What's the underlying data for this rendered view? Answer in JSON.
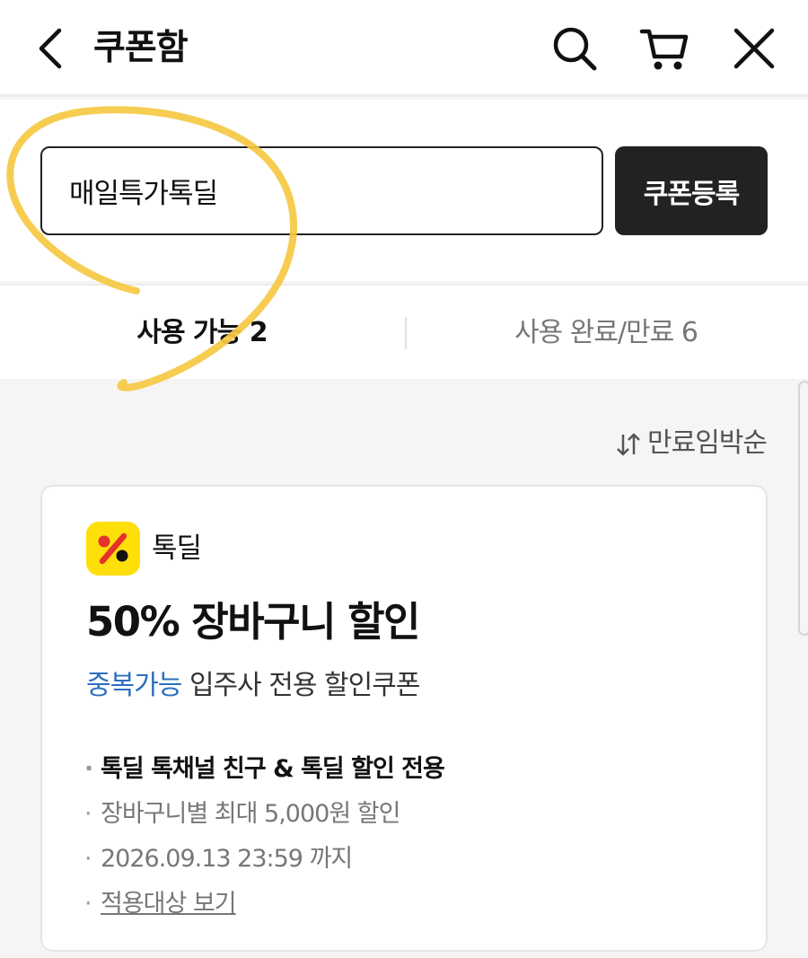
{
  "header": {
    "title": "쿠폰함",
    "icons": [
      "back-icon",
      "search-icon",
      "cart-icon",
      "close-icon"
    ]
  },
  "register": {
    "input_value": "매일특가톡딜",
    "button_label": "쿠폰등록"
  },
  "tabs": [
    {
      "label": "사용 가능 2",
      "active": true
    },
    {
      "label": "사용 완료/만료 6",
      "active": false
    }
  ],
  "sort": {
    "label": "만료임박순",
    "icon": "sort-arrows-icon"
  },
  "coupon": {
    "brand_name": "톡딜",
    "brand_icon": "percent-logo-icon",
    "title": "50% 장바구니 할인",
    "tag_highlight": "중복가능",
    "tag_desc": "입주사 전용 할인쿠폰",
    "details": [
      "톡딜 톡채널 친구 & 톡딜 할인 전용",
      "장바구니별 최대 5,000원 할인",
      "2026.09.13 23:59 까지"
    ],
    "link_label": "적용대상 보기"
  },
  "colors": {
    "accent_dark": "#222222",
    "highlight_blue": "#2d6fbf",
    "brand_yellow": "#ffdf0a",
    "annotation_yellow": "#f5c842"
  }
}
